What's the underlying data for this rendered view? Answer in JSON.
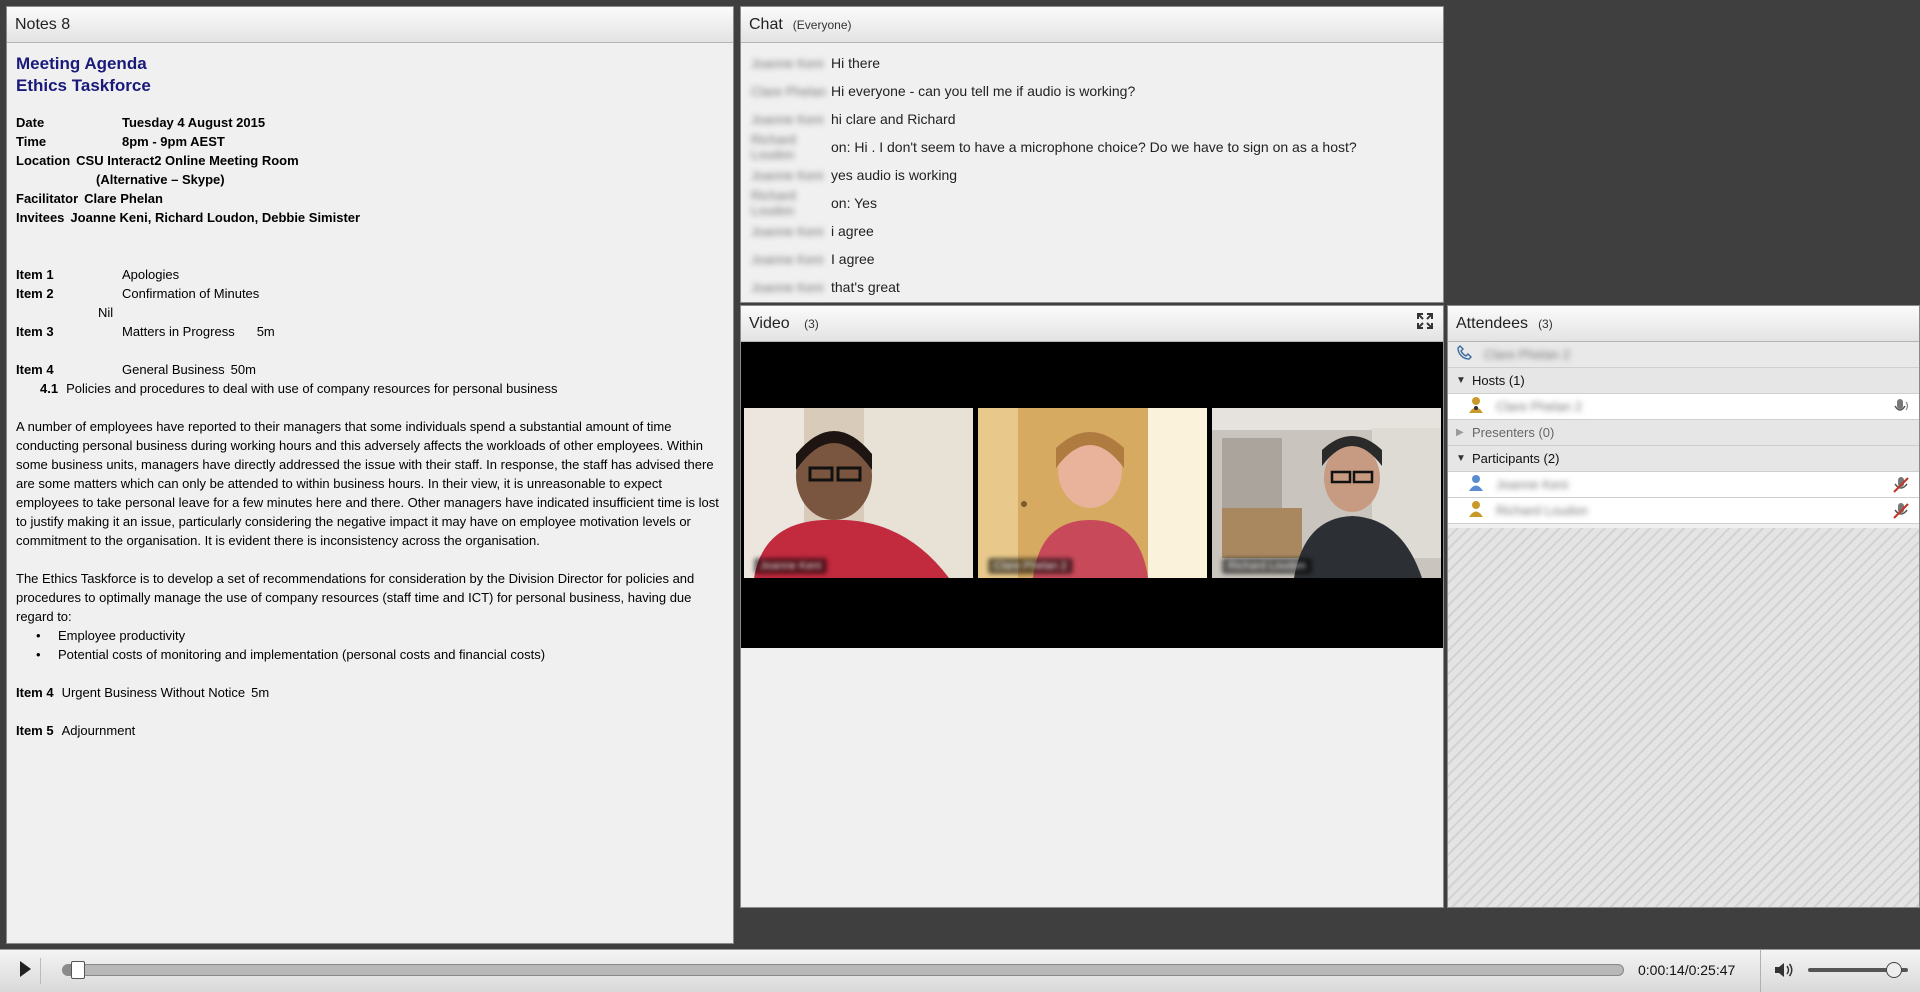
{
  "notes": {
    "title": "Notes 8",
    "heading1": "Meeting Agenda",
    "heading2": "Ethics Taskforce",
    "info": [
      {
        "key": "Date",
        "value": "Tuesday 4 August 2015",
        "indent": true
      },
      {
        "key": "Time",
        "value": "8pm - 9pm AEST",
        "indent": true
      },
      {
        "key": "Location",
        "value": "CSU Interact2 Online Meeting Room",
        "indent": false
      },
      {
        "key": "",
        "value": "(Alternative – Skype)",
        "indent": false
      },
      {
        "key": "Facilitator",
        "value": "Clare Phelan",
        "indent": false
      },
      {
        "key": "Invitees",
        "value": "Joanne Keni, Richard Loudon, Debbie Simister",
        "indent": false
      }
    ],
    "item1_key": "Item 1",
    "item1_text": "Apologies",
    "item2_key": "Item 2",
    "item2_text": "Confirmation of Minutes",
    "item2_sub": "Nil",
    "item3_key": "Item 3",
    "item3_text": "Matters in Progress",
    "item3_time": "5m",
    "item4_key": "Item 4",
    "item4_text": "General Business",
    "item4_time": "50m",
    "item41_num": "4.1",
    "item41_text": "Policies and procedures to deal with use of company resources for personal business",
    "para1": "A number of employees have reported to their managers that some individuals spend a substantial amount of time conducting personal business during working hours and this adversely affects the workloads of other employees. Within some business units, managers have directly addressed the issue with their staff. In response, the staff has advised there are some matters which can only be attended to within business hours. In their view, it is unreasonable to expect employees to take personal leave for a few minutes here and there. Other managers have indicated insufficient time is lost to justify making it an issue, particularly considering the negative impact it may have on employee motivation levels or commitment to the organisation. It is evident there is inconsistency across the organisation.",
    "para2": "The Ethics Taskforce is to develop a set of recommendations for consideration by the Division Director for policies and procedures to optimally manage the use of company resources (staff time and ICT) for personal business, having due regard to:",
    "bullet1": "Employee productivity",
    "bullet2": "Potential costs of monitoring and implementation (personal costs and financial costs)",
    "item4b_key": "Item 4",
    "item4b_text": "Urgent Business Without Notice",
    "item4b_time": "5m",
    "item5_key": "Item 5",
    "item5_text": "Adjournment"
  },
  "chat": {
    "title": "Chat",
    "scope": "(Everyone)",
    "messages": [
      {
        "name": "Joanne Keni",
        "text": "Hi there"
      },
      {
        "name": "Clare Phelan",
        "text": "Hi everyone - can you tell me if audio is working?"
      },
      {
        "name": "Joanne Keni",
        "text": "hi clare and Richard"
      },
      {
        "name": "Richard Loudon",
        "text": "on: Hi . I don't seem to have a microphone choice? Do we have to sign on as a host?"
      },
      {
        "name": "Joanne Keni",
        "text": "yes audio is working"
      },
      {
        "name": "Richard Loudon",
        "text": "on: Yes"
      },
      {
        "name": "Joanne Keni",
        "text": "i agree"
      },
      {
        "name": "Joanne Keni",
        "text": "I agree"
      },
      {
        "name": "Joanne Keni",
        "text": "that's great"
      }
    ]
  },
  "video": {
    "title": "Video",
    "count": "(3)",
    "tiles": [
      {
        "name": "Joanne Keni",
        "bg": "#c9b7a2"
      },
      {
        "name": "Clare Phelan 2",
        "bg": "#c8a05a"
      },
      {
        "name": "Richard Loudon",
        "bg": "#9b9590"
      }
    ]
  },
  "attendees": {
    "title": "Attendees",
    "count": "(3)",
    "phone_user": "Clare Phelan 2",
    "hosts_label": "Hosts (1)",
    "host_name": "Clare Phelan 2",
    "presenters_label": "Presenters (0)",
    "participants_label": "Participants (2)",
    "participants": [
      {
        "name": "Joanne Keni"
      },
      {
        "name": "Richard Loudon"
      }
    ]
  },
  "playback": {
    "time": "0:00:14/0:25:47",
    "progress_fraction": 0.009,
    "volume_fraction": 0.85
  },
  "colors": {
    "heading": "#1a1a7a",
    "user_icon": "#c79a2a",
    "participant_icon": "#5a8ccf",
    "mic_muted": "#c0392b"
  }
}
